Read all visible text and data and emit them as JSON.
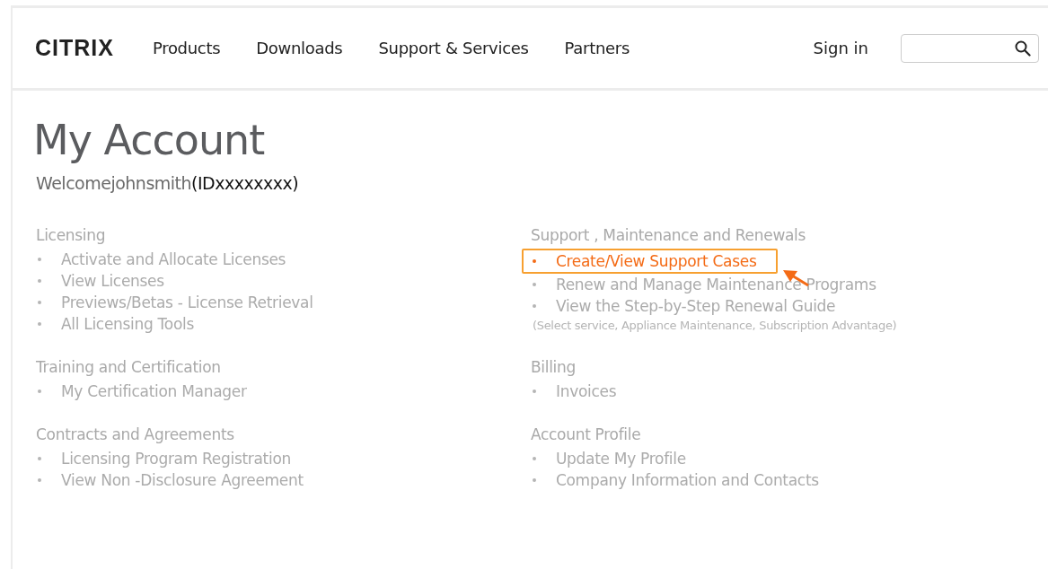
{
  "header": {
    "logo": "CITRIX",
    "nav": [
      {
        "label": "Products"
      },
      {
        "label": "Downloads"
      },
      {
        "label": "Support & Services"
      },
      {
        "label": "Partners"
      }
    ],
    "sign_in": "Sign in"
  },
  "title": "My Account",
  "welcome": "Welcomejohnsmith",
  "account_id": "(IDxxxxxxxx)",
  "columns": [
    {
      "sections": [
        {
          "heading": "Licensing",
          "items": [
            {
              "label": "Activate and Allocate Licenses",
              "highlighted": false
            },
            {
              "label": "View Licenses",
              "highlighted": false
            },
            {
              "label": "Previews/Betas - License Retrieval",
              "highlighted": false
            },
            {
              "label": "All Licensing Tools",
              "highlighted": false
            }
          ]
        },
        {
          "heading": "Training and Certification",
          "items": [
            {
              "label": "My Certification Manager",
              "highlighted": false
            }
          ]
        },
        {
          "heading": "Contracts and Agreements",
          "items": [
            {
              "label": "Licensing Program Registration",
              "highlighted": false
            },
            {
              "label": "View Non -Disclosure Agreement",
              "highlighted": false
            }
          ]
        }
      ]
    },
    {
      "sections": [
        {
          "heading": "Support , Maintenance and Renewals",
          "items": [
            {
              "label": "Create/View Support Cases",
              "highlighted": true
            },
            {
              "label": "Renew and Manage Maintenance Programs",
              "highlighted": false
            },
            {
              "label": "View the Step-by-Step Renewal Guide",
              "highlighted": false
            }
          ],
          "note": "(Select service, Appliance Maintenance, Subscription Advantage)"
        },
        {
          "heading": "Billing",
          "items": [
            {
              "label": "Invoices",
              "highlighted": false
            }
          ]
        },
        {
          "heading": "Account Profile",
          "items": [
            {
              "label": "Update My Profile",
              "highlighted": false
            },
            {
              "label": "Company Information and Contacts",
              "highlighted": false
            }
          ]
        }
      ]
    }
  ]
}
